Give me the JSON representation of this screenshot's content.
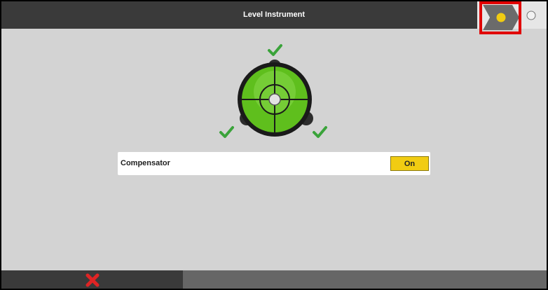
{
  "header": {
    "title": "Level Instrument"
  },
  "steps": {
    "current_icon": "current-step-marker-icon",
    "next_icon": "next-step-circle-icon"
  },
  "level": {
    "icon": "circular-bubble-level-icon",
    "check_icon": "checkmark-icon"
  },
  "compensator": {
    "label": "Compensator",
    "value": "On"
  },
  "footer": {
    "cancel_icon": "cancel-x-icon"
  },
  "colors": {
    "header_bg": "#3a3a3a",
    "content_bg": "#d3d3d3",
    "accent_yellow": "#f1cc12",
    "bubble_green": "#5fbf1d",
    "check_green": "#3aa33a",
    "cancel_red": "#e02424",
    "highlight_red": "#e00000"
  }
}
